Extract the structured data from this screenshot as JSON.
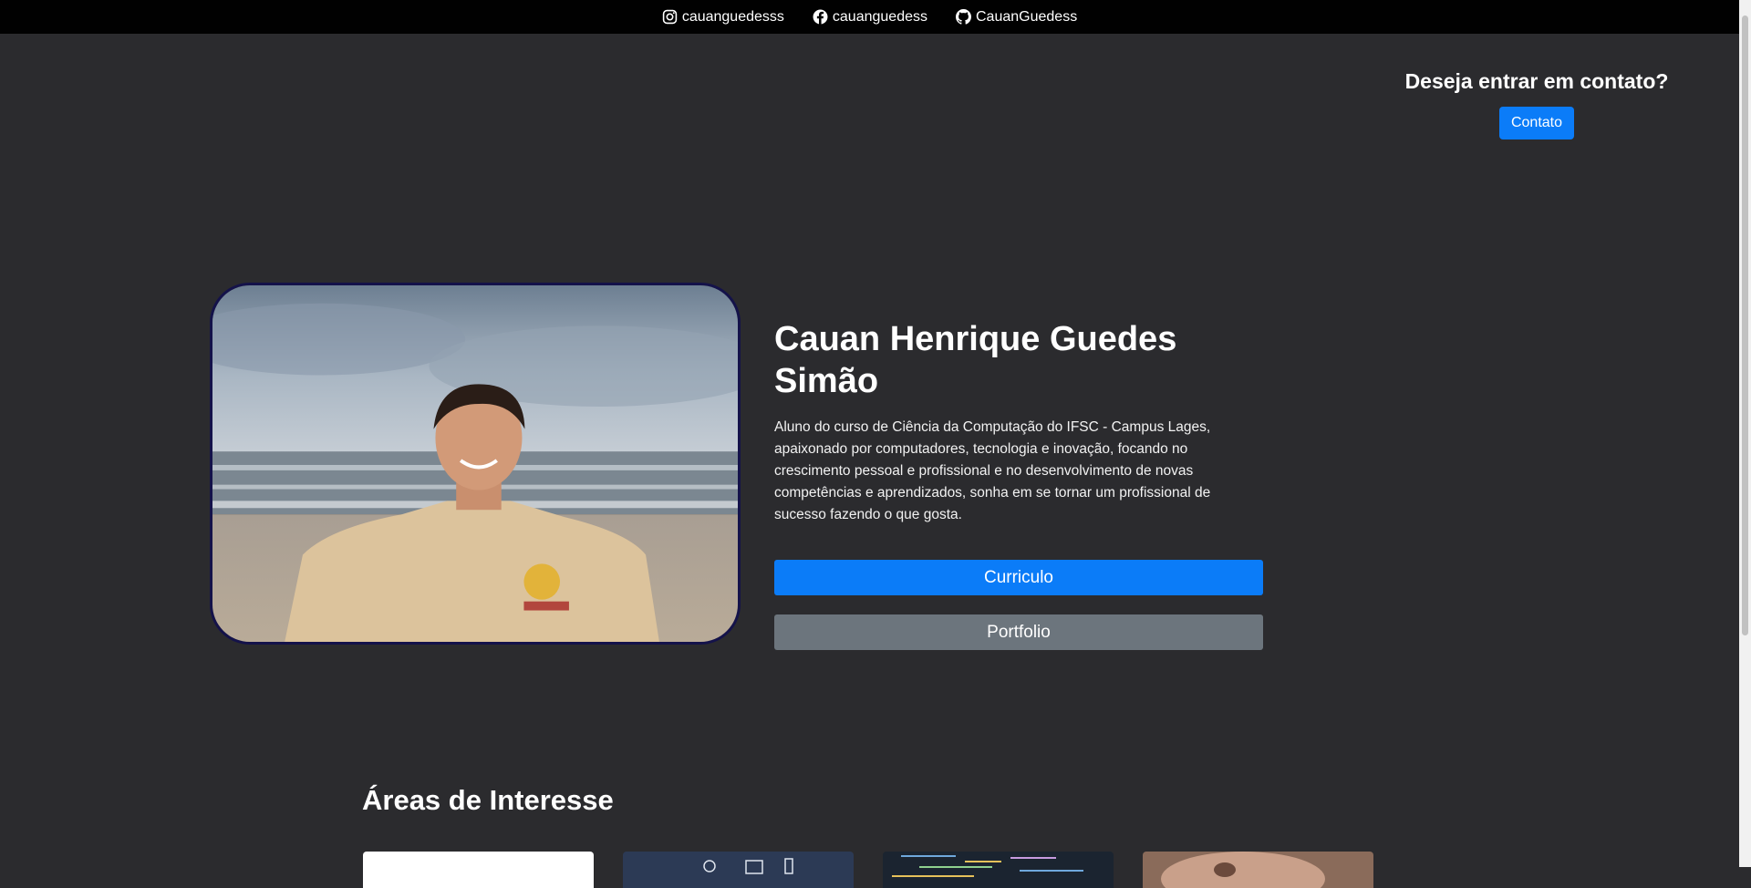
{
  "topbar": {
    "links": [
      {
        "icon": "instagram-icon",
        "label": "cauanguedesss"
      },
      {
        "icon": "facebook-icon",
        "label": "cauanguedess"
      },
      {
        "icon": "github-icon",
        "label": "CauanGuedess"
      }
    ]
  },
  "contact": {
    "title": "Deseja entrar em contato?",
    "button_label": "Contato"
  },
  "hero": {
    "name": "Cauan Henrique Guedes Simão",
    "description": "Aluno do curso de Ciência da Computação do IFSC - Campus Lages, apaixonado por computadores, tecnologia e inovação, focando no crescimento pessoal e profissional e no desenvolvimento de novas competências e aprendizados, sonha em se tornar um profissional de sucesso fazendo o que gosta.",
    "curriculo_label": "Curriculo",
    "portfolio_label": "Portfolio"
  },
  "areas": {
    "title": "Áreas de Interesse"
  },
  "colors": {
    "background": "#2b2b2e",
    "topbar": "#010101",
    "primary": "#0b7cf8",
    "secondary": "#6c757d",
    "photo_border": "#14124a"
  }
}
